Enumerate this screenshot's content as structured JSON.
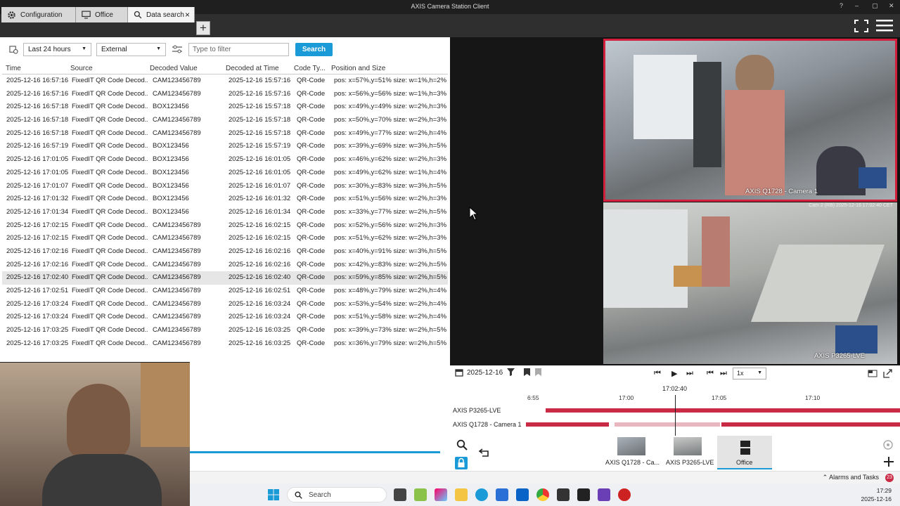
{
  "window": {
    "title": "AXIS Camera Station Client",
    "help": "?",
    "min": "–",
    "max": "▢",
    "close": "✕"
  },
  "tabs": [
    {
      "label": "Configuration"
    },
    {
      "label": "Office"
    },
    {
      "label": "Data search"
    }
  ],
  "filters": {
    "time_range": "Last 24 hours",
    "source": "External",
    "filter_placeholder": "Type to filter",
    "search_label": "Search"
  },
  "table": {
    "columns": [
      "Time",
      "Source",
      "Decoded Value",
      "Decoded at Time",
      "Code Ty...",
      "Position and Size"
    ],
    "selected_index": 15,
    "rows": [
      [
        "2025-12-16 16:57:16",
        "FixedIT QR Code Decod...",
        "CAM123456789",
        "2025-12-16 15:57:16",
        "QR-Code",
        "pos: x=57%,y=51% size: w=1%,h=2%"
      ],
      [
        "2025-12-16 16:57:16",
        "FixedIT QR Code Decod...",
        "CAM123456789",
        "2025-12-16 15:57:16",
        "QR-Code",
        "pos: x=56%,y=56% size: w=1%,h=3%"
      ],
      [
        "2025-12-16 16:57:18",
        "FixedIT QR Code Decod...",
        "BOX123456",
        "2025-12-16 15:57:18",
        "QR-Code",
        "pos: x=49%,y=49% size: w=2%,h=3%"
      ],
      [
        "2025-12-16 16:57:18",
        "FixedIT QR Code Decod...",
        "CAM123456789",
        "2025-12-16 15:57:18",
        "QR-Code",
        "pos: x=50%,y=70% size: w=2%,h=3%"
      ],
      [
        "2025-12-16 16:57:18",
        "FixedIT QR Code Decod...",
        "CAM123456789",
        "2025-12-16 15:57:18",
        "QR-Code",
        "pos: x=49%,y=77% size: w=2%,h=4%"
      ],
      [
        "2025-12-16 16:57:19",
        "FixedIT QR Code Decod...",
        "BOX123456",
        "2025-12-16 15:57:19",
        "QR-Code",
        "pos: x=39%,y=69% size: w=3%,h=5%"
      ],
      [
        "2025-12-16 17:01:05",
        "FixedIT QR Code Decod...",
        "BOX123456",
        "2025-12-16 16:01:05",
        "QR-Code",
        "pos: x=46%,y=62% size: w=2%,h=3%"
      ],
      [
        "2025-12-16 17:01:05",
        "FixedIT QR Code Decod...",
        "BOX123456",
        "2025-12-16 16:01:05",
        "QR-Code",
        "pos: x=49%,y=62% size: w=1%,h=4%"
      ],
      [
        "2025-12-16 17:01:07",
        "FixedIT QR Code Decod...",
        "BOX123456",
        "2025-12-16 16:01:07",
        "QR-Code",
        "pos: x=30%,y=83% size: w=3%,h=5%"
      ],
      [
        "2025-12-16 17:01:32",
        "FixedIT QR Code Decod...",
        "BOX123456",
        "2025-12-16 16:01:32",
        "QR-Code",
        "pos: x=51%,y=56% size: w=2%,h=3%"
      ],
      [
        "2025-12-16 17:01:34",
        "FixedIT QR Code Decod...",
        "BOX123456",
        "2025-12-16 16:01:34",
        "QR-Code",
        "pos: x=33%,y=77% size: w=2%,h=5%"
      ],
      [
        "2025-12-16 17:02:15",
        "FixedIT QR Code Decod...",
        "CAM123456789",
        "2025-12-16 16:02:15",
        "QR-Code",
        "pos: x=52%,y=56% size: w=2%,h=3%"
      ],
      [
        "2025-12-16 17:02:15",
        "FixedIT QR Code Decod...",
        "CAM123456789",
        "2025-12-16 16:02:15",
        "QR-Code",
        "pos: x=51%,y=62% size: w=2%,h=3%"
      ],
      [
        "2025-12-16 17:02:16",
        "FixedIT QR Code Decod...",
        "CAM123456789",
        "2025-12-16 16:02:16",
        "QR-Code",
        "pos: x=40%,y=91% size: w=3%,h=5%"
      ],
      [
        "2025-12-16 17:02:16",
        "FixedIT QR Code Decod...",
        "CAM123456789",
        "2025-12-16 16:02:16",
        "QR-Code",
        "pos: x=42%,y=83% size: w=2%,h=5%"
      ],
      [
        "2025-12-16 17:02:40",
        "FixedIT QR Code Decod...",
        "CAM123456789",
        "2025-12-16 16:02:40",
        "QR-Code",
        "pos: x=59%,y=85% size: w=2%,h=5%"
      ],
      [
        "2025-12-16 17:02:51",
        "FixedIT QR Code Decod...",
        "CAM123456789",
        "2025-12-16 16:02:51",
        "QR-Code",
        "pos: x=48%,y=79% size: w=2%,h=4%"
      ],
      [
        "2025-12-16 17:03:24",
        "FixedIT QR Code Decod...",
        "CAM123456789",
        "2025-12-16 16:03:24",
        "QR-Code",
        "pos: x=53%,y=54% size: w=2%,h=4%"
      ],
      [
        "2025-12-16 17:03:24",
        "FixedIT QR Code Decod...",
        "CAM123456789",
        "2025-12-16 16:03:24",
        "QR-Code",
        "pos: x=51%,y=58% size: w=2%,h=4%"
      ],
      [
        "2025-12-16 17:03:25",
        "FixedIT QR Code Decod...",
        "CAM123456789",
        "2025-12-16 16:03:25",
        "QR-Code",
        "pos: x=39%,y=73% size: w=2%,h=5%"
      ],
      [
        "2025-12-16 17:03:25",
        "FixedIT QR Code Decod...",
        "CAM123456789",
        "2025-12-16 16:03:25",
        "QR-Code",
        "pos: x=36%,y=79% size: w=2%,h=5%"
      ]
    ]
  },
  "cameras": {
    "cam1_label": "AXIS Q1728 - Camera 1",
    "cam2_label": "AXIS P3265-LVE",
    "cam2_timestamp": "Cam 2 (RB) 2025-12-16 17:02:40 CET"
  },
  "timeline": {
    "date": "2025-12-16",
    "speed": "1x",
    "current_time": "17:02:40",
    "ticks": [
      "6:55",
      "17:00",
      "17:05",
      "17:10"
    ],
    "rows": [
      "AXIS P3265-LVE",
      "AXIS Q1728 - Camera 1"
    ]
  },
  "views": [
    {
      "label": "AXIS Q1728 - Ca..."
    },
    {
      "label": "AXIS P3265-LVE"
    },
    {
      "label": "Office"
    }
  ],
  "statusbar": {
    "alarms_label": "Alarms and Tasks",
    "alarms_count": "23"
  },
  "taskbar": {
    "search_label": "Search",
    "time": "17:29",
    "date": "2025-12-16"
  },
  "colors": {
    "accent": "#1a9ad6",
    "alarm_red": "#c92a45",
    "camera_border": "#d11f3c"
  }
}
